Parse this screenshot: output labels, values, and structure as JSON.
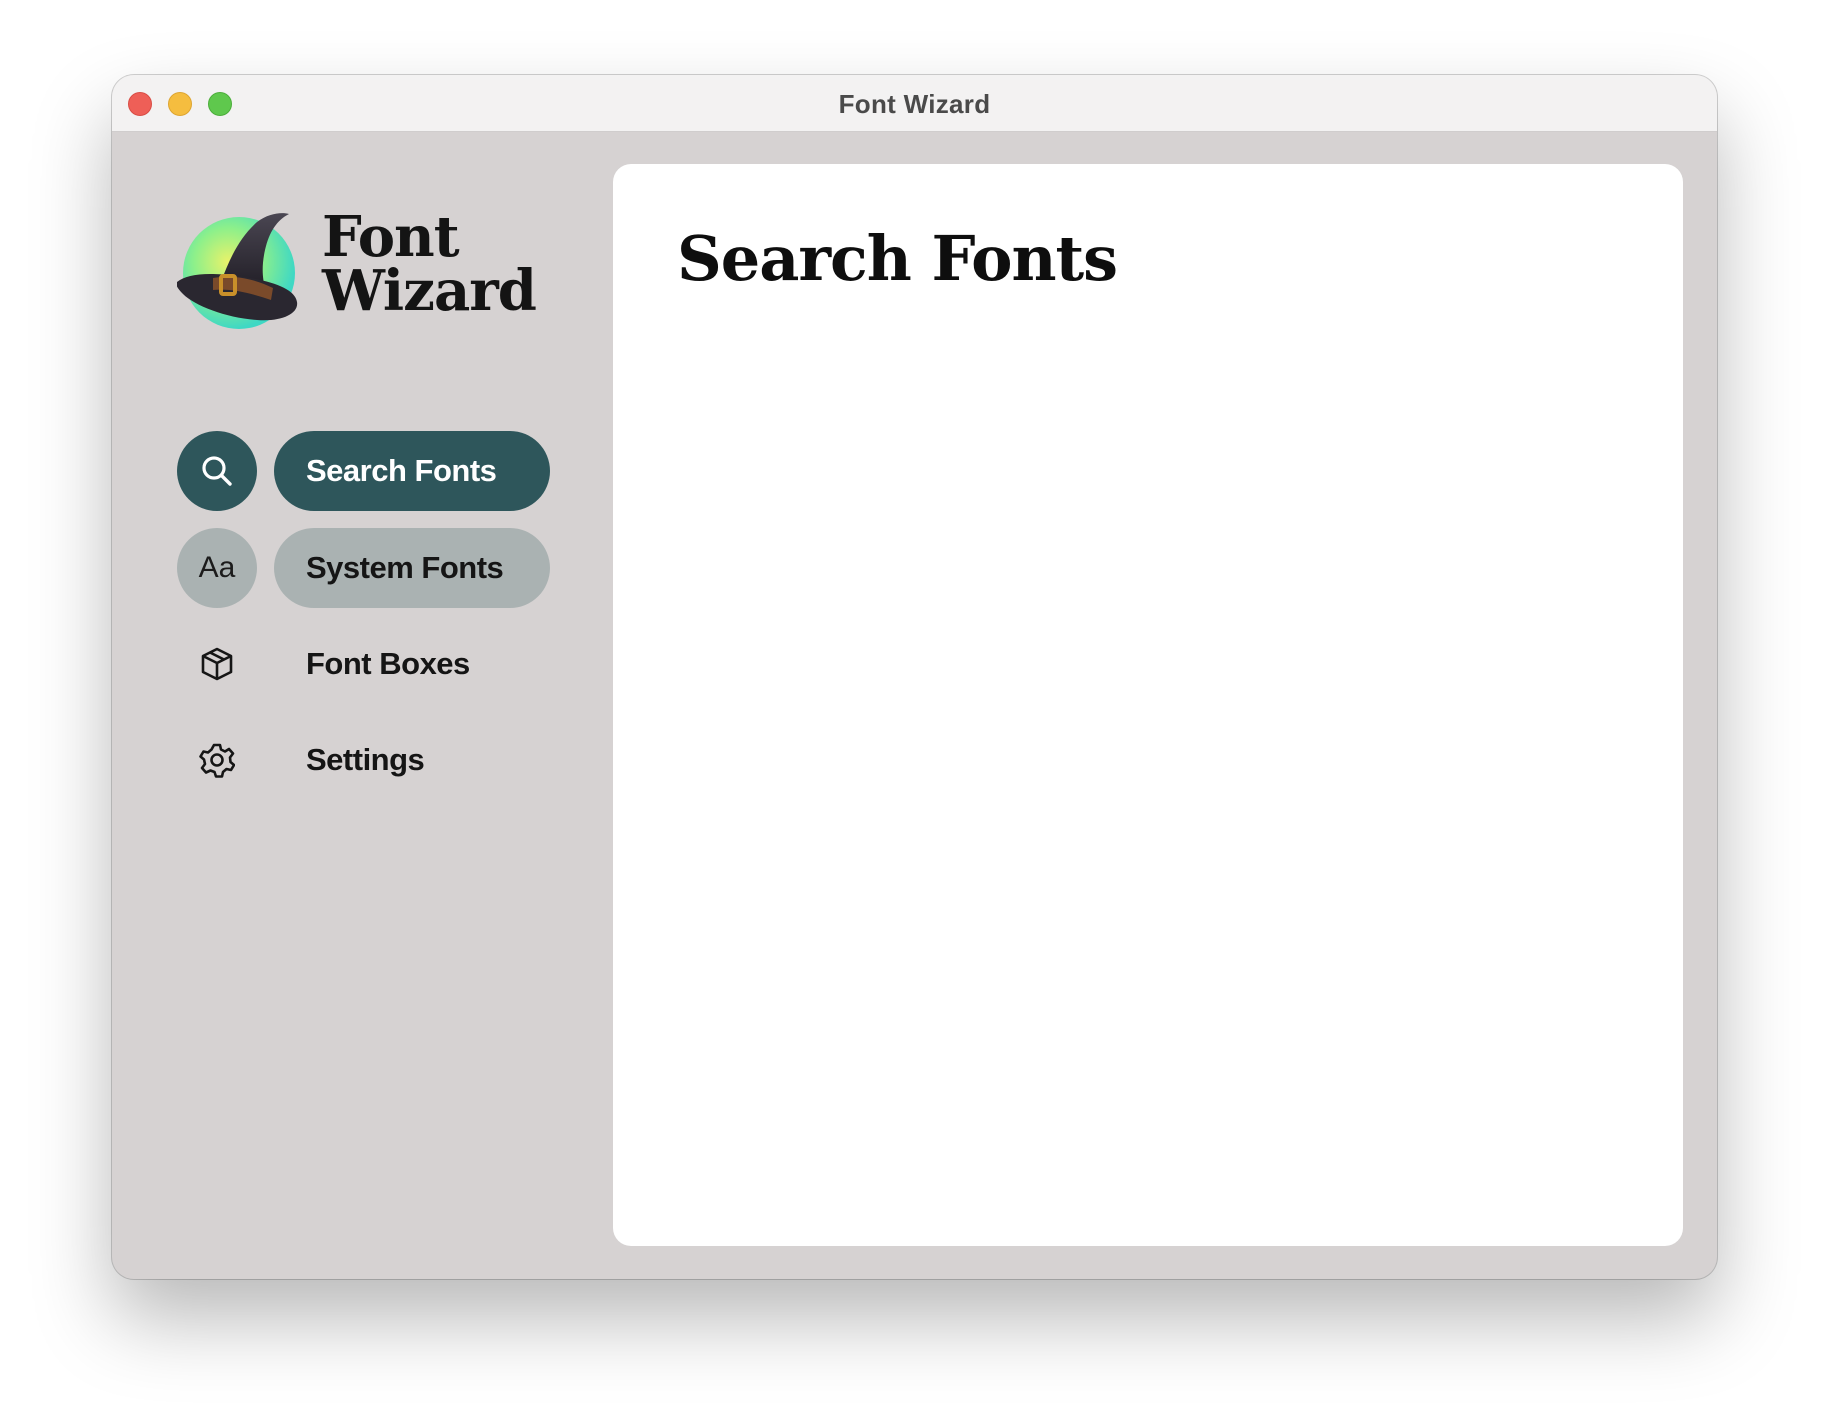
{
  "window": {
    "title": "Font Wizard"
  },
  "logo": {
    "line1": "Font",
    "line2": "Wizard",
    "icon": "wizard-hat-icon"
  },
  "sidebar": {
    "items": [
      {
        "label": "Search Fonts",
        "icon": "search-icon",
        "state": "active"
      },
      {
        "label": "System Fonts",
        "icon": "aa-text-icon",
        "icon_text": "Aa",
        "state": "hover"
      },
      {
        "label": "Font Boxes",
        "icon": "box-icon",
        "state": "normal"
      },
      {
        "label": "Settings",
        "icon": "gear-icon",
        "state": "normal"
      }
    ]
  },
  "main": {
    "title": "Search Fonts"
  },
  "colors": {
    "sidebar_bg": "#d6d2d2",
    "active_accent": "#2e565b",
    "hover_bg": "#aab2b2",
    "content_bg": "#ffffff"
  }
}
